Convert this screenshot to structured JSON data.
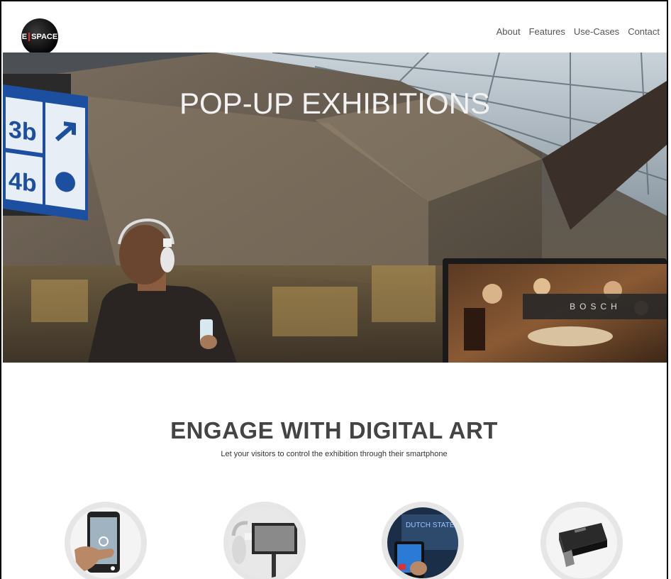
{
  "header": {
    "logo_text_e": "E",
    "logo_text_space": "SPACE",
    "nav": [
      "About",
      "Features",
      "Use-Cases",
      "Contact"
    ]
  },
  "hero": {
    "title": "POP-UP EXHIBITIONS",
    "sign_numbers": [
      "3b",
      "4b"
    ],
    "panel_text": "BOSCH",
    "screen_text": "DUTCH STATE"
  },
  "section": {
    "title": "ENGAGE WITH DIGITAL ART",
    "subtitle": "Let your visitors to control the exhibition through their smartphone"
  },
  "features": [
    {
      "icon": "smartphone-hand-icon"
    },
    {
      "icon": "headphones-screen-icon"
    },
    {
      "icon": "tablet-screen-icon"
    },
    {
      "icon": "hdmi-stick-icon"
    }
  ],
  "colors": {
    "title_color": "#444444",
    "hero_overlay": "#5a564f",
    "accent_red": "#e03030"
  }
}
